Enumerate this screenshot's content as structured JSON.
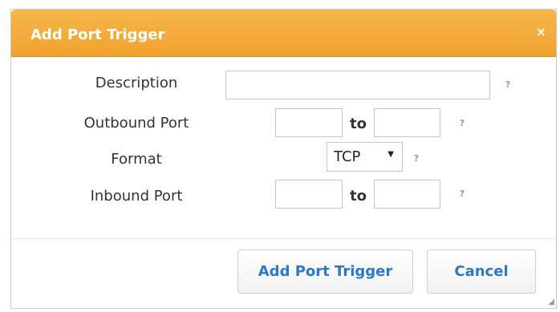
{
  "dialog": {
    "title": "Add Port Trigger",
    "close_glyph": "×",
    "fields": {
      "description": {
        "label": "Description",
        "value": ""
      },
      "outbound_port": {
        "label": "Outbound Port",
        "from_value": "",
        "to_label": "to",
        "to_value": ""
      },
      "format": {
        "label": "Format",
        "selected": "TCP"
      },
      "inbound_port": {
        "label": "Inbound Port",
        "from_value": "",
        "to_label": "to",
        "to_value": ""
      }
    },
    "help_glyph": "?",
    "buttons": {
      "primary": "Add Port Trigger",
      "cancel": "Cancel"
    }
  },
  "colors": {
    "header": "#f0a12e",
    "button_text": "#2a79c6"
  }
}
